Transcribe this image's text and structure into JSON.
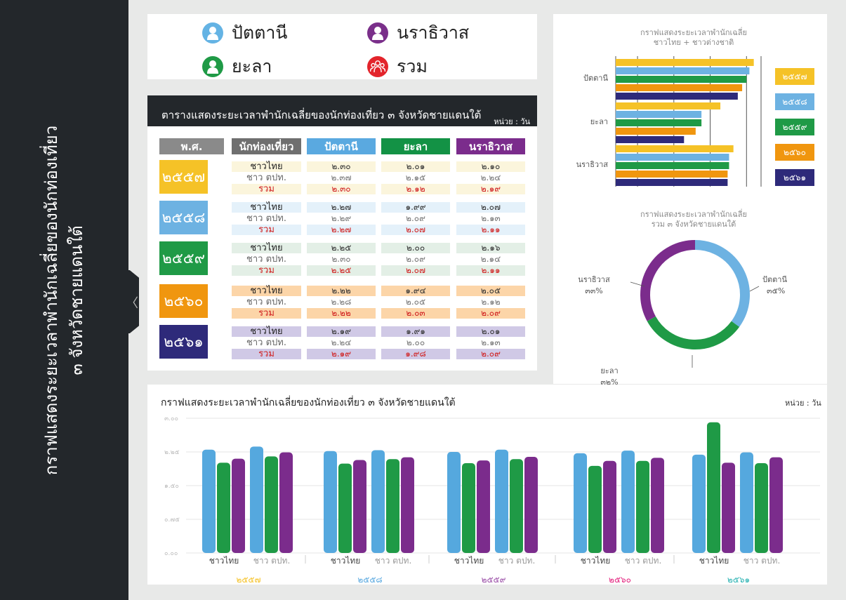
{
  "sidebar": {
    "title": "กราฟแสดงระยะเวลาพำนักเฉลี่ยของนักท่องเที่ยว\n๓ จังหวัดชายแดนใต้",
    "collapse_icon": "chevron-left-icon"
  },
  "legend": {
    "items": [
      {
        "label": "ปัตตานี",
        "color": "#64b3e4",
        "icon": "person-icon"
      },
      {
        "label": "นราธิวาส",
        "color": "#7a2f8a",
        "icon": "person-icon"
      },
      {
        "label": "ยะลา",
        "color": "#1f9a46",
        "icon": "person-icon"
      },
      {
        "label": "รวม",
        "color": "#e3242b",
        "icon": "group-icon"
      }
    ]
  },
  "table": {
    "title": "ตารางแสดงระยะเวลาพำนักเฉลี่ยของนักท่องเที่ยว ๓ จังหวัดชายแดนใต้",
    "unit": "หน่วย : วัน",
    "headers": [
      "พ.ศ.",
      "นักท่องเที่ยว",
      "ปัตตานี",
      "ยะลา",
      "นราธิวาส"
    ],
    "header_colors": [
      "#8a8a8a",
      "#6f6f6f",
      "#5aa9e0",
      "#139245",
      "#7b2c8c"
    ],
    "row_labels": [
      "ชาวไทย",
      "ชาว ตปท.",
      "รวม"
    ],
    "years": [
      {
        "year": "๒๕๕๗",
        "color": "#f5c227",
        "tint": "#fbf5dc",
        "values": [
          [
            "๒.๓๐",
            "๒.๐๑",
            "๒.๑๐"
          ],
          [
            "๒.๓๗",
            "๒.๑๕",
            "๒.๒๔"
          ],
          [
            "๒.๓๐",
            "๒.๑๒",
            "๒.๑๙"
          ]
        ]
      },
      {
        "year": "๒๕๕๘",
        "color": "#6db2e2",
        "tint": "#e4f1fa",
        "values": [
          [
            "๒.๒๗",
            "๑.๙๙",
            "๒.๐๗"
          ],
          [
            "๒.๒๙",
            "๒.๐๙",
            "๒.๑๓"
          ],
          [
            "๒.๒๗",
            "๒.๐๗",
            "๒.๑๑"
          ]
        ]
      },
      {
        "year": "๒๕๕๙",
        "color": "#1f9a46",
        "tint": "#e3efe6",
        "values": [
          [
            "๒.๒๕",
            "๒.๐๐",
            "๒.๑๖"
          ],
          [
            "๒.๓๐",
            "๒.๐๙",
            "๒.๑๔"
          ],
          [
            "๒.๒๕",
            "๒.๐๗",
            "๒.๑๑"
          ]
        ]
      },
      {
        "year": "๒๕๖๐",
        "color": "#f0960f",
        "tint": "#fcd5a8",
        "values": [
          [
            "๒.๒๒",
            "๑.๙๔",
            "๒.๐๕"
          ],
          [
            "๒.๒๘",
            "๒.๐๕",
            "๒.๑๒"
          ],
          [
            "๒.๒๒",
            "๒.๐๓",
            "๒.๐๙"
          ]
        ]
      },
      {
        "year": "๒๕๖๑",
        "color": "#2e2a7a",
        "tint": "#d0c9e6",
        "values": [
          [
            "๒.๑๙",
            "๑.๙๑",
            "๒.๐๑"
          ],
          [
            "๒.๒๔",
            "๒.๐๐",
            "๒.๑๓"
          ],
          [
            "๒.๑๙",
            "๑.๙๘",
            "๒.๐๙"
          ]
        ]
      }
    ]
  },
  "bar_chart_title_lines": [
    "กราฟแสดงระยะเวลาพำนักเฉลี่ย",
    "ชาวไทย + ชาวต่างชาติ"
  ],
  "pie_chart_title_lines": [
    "กราฟแสดงระยะเวลาพำนักเฉลี่ย",
    "รวม ๓ จังหวัดชายแดนใต้"
  ],
  "bottom_chart": {
    "title": "กราฟแสดงระยะเวลาพำนักเฉลี่ยของนักท่องเที่ยว ๓ จังหวัดชายแดนใต้",
    "unit": "หน่วย : วัน"
  },
  "chart_data": [
    {
      "type": "bar",
      "orientation": "horizontal",
      "categories": [
        "ปัตตานี",
        "ยะลา",
        "นราธิวาส"
      ],
      "series": [
        {
          "name": "๒๕๕๗",
          "color": "#f5c227",
          "values": [
            2.3,
            2.07,
            2.16
          ]
        },
        {
          "name": "๒๕๕๘",
          "color": "#6db2e2",
          "values": [
            2.27,
            1.94,
            2.13
          ]
        },
        {
          "name": "๒๕๕๙",
          "color": "#1f9a46",
          "values": [
            2.25,
            1.94,
            2.13
          ]
        },
        {
          "name": "๒๕๖๐",
          "color": "#f0960f",
          "values": [
            2.22,
            1.9,
            2.12
          ]
        },
        {
          "name": "๒๕๖๑",
          "color": "#2e2a7a",
          "values": [
            2.19,
            1.82,
            2.12
          ]
        }
      ],
      "xlim": [
        1.35,
        2.35
      ],
      "grid": true,
      "legend_position": "right"
    },
    {
      "type": "pie",
      "donut": true,
      "slices": [
        {
          "label": "ปัตตานี",
          "value_text": "๓๕%",
          "value": 35,
          "color": "#6db2e2"
        },
        {
          "label": "ยะลา",
          "value_text": "๓๒%",
          "value": 32,
          "color": "#1f9a46"
        },
        {
          "label": "นราธิวาส",
          "value_text": "๓๓%",
          "value": 33,
          "color": "#7b2c8c"
        }
      ]
    },
    {
      "type": "bar",
      "groups": [
        "๒๕๕๗",
        "๒๕๕๘",
        "๒๕๕๙",
        "๒๕๖๐",
        "๒๕๖๑"
      ],
      "group_colors": [
        "#f5c227",
        "#5aa9e0",
        "#9b4fa8",
        "#e3247f",
        "#2bb3b3"
      ],
      "subgroups": [
        "ชาวไทย",
        "ชาว ตปท."
      ],
      "series": [
        {
          "name": "ปัตตานี",
          "color": "#55a8de",
          "values": [
            [
              2.3,
              2.37
            ],
            [
              2.27,
              2.29
            ],
            [
              2.25,
              2.3
            ],
            [
              2.22,
              2.28
            ],
            [
              2.19,
              2.24
            ]
          ]
        },
        {
          "name": "ยะลา",
          "color": "#1f9a46",
          "values": [
            [
              2.01,
              2.15
            ],
            [
              1.99,
              2.09
            ],
            [
              2.0,
              2.09
            ],
            [
              1.94,
              2.05
            ],
            [
              2.91,
              2.0
            ]
          ]
        },
        {
          "name": "นราธิวาส",
          "color": "#7b2c8c",
          "values": [
            [
              2.1,
              2.24
            ],
            [
              2.07,
              2.13
            ],
            [
              2.06,
              2.14
            ],
            [
              2.05,
              2.12
            ],
            [
              2.01,
              2.13
            ]
          ]
        }
      ],
      "ytick_labels": [
        "๐.๐๐",
        "๐.๗๕",
        "๑.๕๐",
        "๒.๒๕",
        "๓.๐๐"
      ],
      "ylim": [
        0,
        3.0
      ],
      "grid": true
    }
  ]
}
